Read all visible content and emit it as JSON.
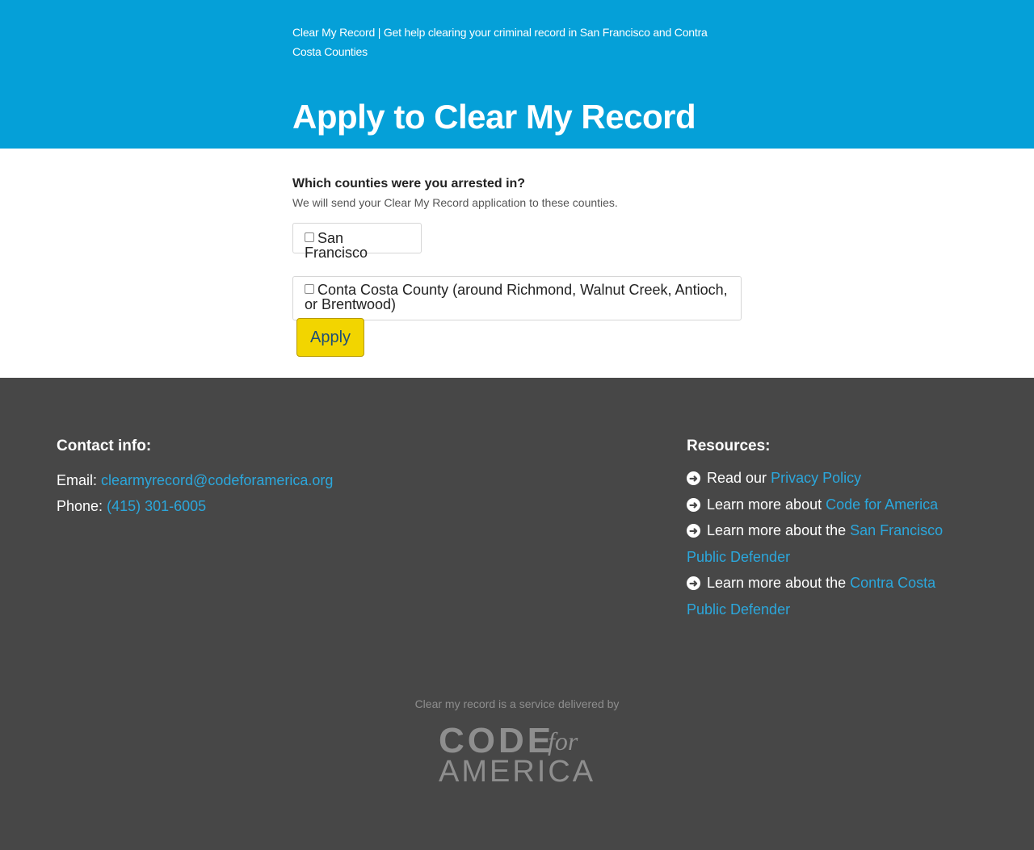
{
  "header": {
    "site_title": "Clear My Record | Get help clearing your criminal record in San Francisco and Contra Costa Counties",
    "page_title": "Apply to Clear My Record",
    "background_color": "#05a0d8"
  },
  "form": {
    "question": "Which counties were you arrested in?",
    "help_text": "We will send your Clear My Record application to these counties.",
    "options": [
      {
        "label": "San Francisco",
        "checked": false
      },
      {
        "label": "Conta Costa County (around Richmond, Walnut Creek, Antioch, or Brentwood)",
        "checked": false
      }
    ],
    "submit_label": "Apply",
    "submit_color": "#f2d500"
  },
  "footer": {
    "contact": {
      "heading": "Contact info:",
      "email_label": "Email:",
      "email": "clearmyrecord@codeforamerica.org",
      "phone_label": "Phone:",
      "phone": "(415) 301-6005"
    },
    "resources": {
      "heading": "Resources:",
      "items": [
        {
          "prefix": "Read our",
          "link": "Privacy Policy",
          "icon": "arrow-right-circle-icon"
        },
        {
          "prefix": "Learn more about",
          "link": "Code for America",
          "icon": "arrow-right-circle-icon"
        },
        {
          "prefix": "Learn more about the",
          "link": "San Francisco Public Defender",
          "icon": "arrow-right-circle-icon"
        },
        {
          "prefix": "Learn more about the",
          "link": "Contra Costa Public Defender",
          "icon": "arrow-right-circle-icon"
        }
      ]
    },
    "delivered_by": "Clear my record is a service delivered by",
    "logo": {
      "code": "CODE",
      "for": "for",
      "america": "AMERICA"
    },
    "background_color": "#474747",
    "link_color": "#2ba7dc"
  }
}
